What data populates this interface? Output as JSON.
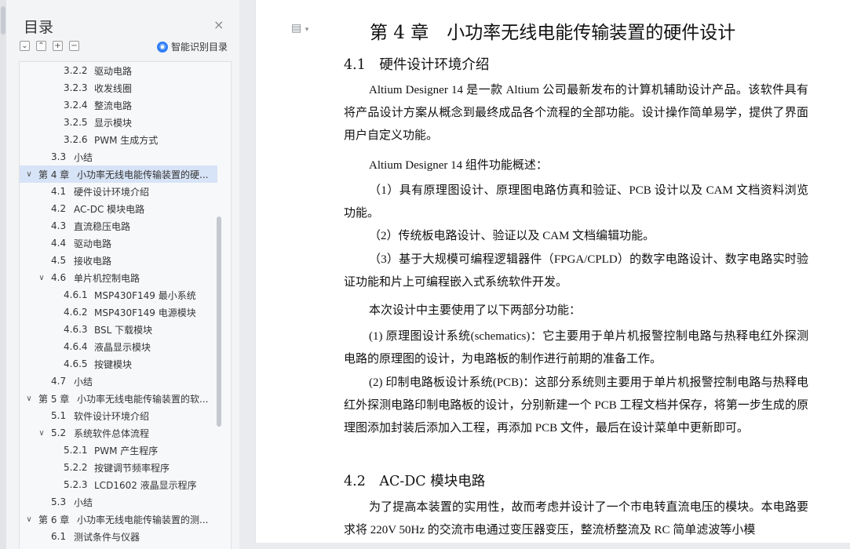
{
  "sidebar": {
    "title": "目录",
    "close_icon": "×",
    "tools": [
      "⌄",
      "⌃",
      "+",
      "−"
    ],
    "smart_toc_label": "智能识别目录",
    "toc": [
      {
        "num": "3.2.2",
        "label": "驱动电路",
        "level": 3
      },
      {
        "num": "3.2.3",
        "label": "收发线圈",
        "level": 3
      },
      {
        "num": "3.2.4",
        "label": "整流电路",
        "level": 3
      },
      {
        "num": "3.2.5",
        "label": "显示模块",
        "level": 3
      },
      {
        "num": "3.2.6",
        "label": "PWM 生成方式",
        "level": 3
      },
      {
        "num": "3.3",
        "label": "小结",
        "level": 2
      },
      {
        "num": "第 4 章",
        "label": "小功率无线电能传输装置的硬...",
        "level": 1,
        "expanded": true,
        "selected": true
      },
      {
        "num": "4.1",
        "label": "硬件设计环境介绍",
        "level": 2
      },
      {
        "num": "4.2",
        "label": "AC-DC 模块电路",
        "level": 2
      },
      {
        "num": "4.3",
        "label": "直流稳压电路",
        "level": 2
      },
      {
        "num": "4.4",
        "label": "驱动电路",
        "level": 2
      },
      {
        "num": "4.5",
        "label": "接收电路",
        "level": 2
      },
      {
        "num": "4.6",
        "label": "单片机控制电路",
        "level": 2,
        "expanded": true
      },
      {
        "num": "4.6.1",
        "label": "MSP430F149 最小系统",
        "level": 3
      },
      {
        "num": "4.6.2",
        "label": "MSP430F149 电源模块",
        "level": 3
      },
      {
        "num": "4.6.3",
        "label": "BSL 下载模块",
        "level": 3
      },
      {
        "num": "4.6.4",
        "label": "液晶显示模块",
        "level": 3
      },
      {
        "num": "4.6.5",
        "label": "按键模块",
        "level": 3
      },
      {
        "num": "4.7",
        "label": "小结",
        "level": 2
      },
      {
        "num": "第 5 章",
        "label": "小功率无线电能传输装置的软...",
        "level": 1,
        "expanded": true
      },
      {
        "num": "5.1",
        "label": "软件设计环境介绍",
        "level": 2
      },
      {
        "num": "5.2",
        "label": "系统软件总体流程",
        "level": 2,
        "expanded": true
      },
      {
        "num": "5.2.1",
        "label": "PWM 产生程序",
        "level": 3
      },
      {
        "num": "5.2.2",
        "label": "按键调节频率程序",
        "level": 3
      },
      {
        "num": "5.2.3",
        "label": "LCD1602 液晶显示程序",
        "level": 3
      },
      {
        "num": "5.3",
        "label": "小结",
        "level": 2
      },
      {
        "num": "第 6 章",
        "label": "小功率无线电能传输装置的测...",
        "level": 1,
        "expanded": true
      },
      {
        "num": "6.1",
        "label": "测试条件与仪器",
        "level": 2
      }
    ]
  },
  "document": {
    "chapter_title": "第 4 章　小功率无线电能传输装置的硬件设计",
    "section1_title": "4.1　硬件设计环境介绍",
    "p1": "Altium Designer 14 是一款 Altium 公司最新发布的计算机辅助设计产品。该软件具有将产品设计方案从概念到最终成品各个流程的全部功能。设计操作简单易学，提供了界面用户自定义功能。",
    "p2": "Altium Designer 14 组件功能概述：",
    "p3": "（1）具有原理图设计、原理图电路仿真和验证、PCB 设计以及 CAM 文档资料浏览功能。",
    "p4": "（2）传统板电路设计、验证以及 CAM 文档编辑功能。",
    "p5": "（3）基于大规模可编程逻辑器件（FPGA/CPLD）的数字电路设计、数字电路实时验证功能和片上可编程嵌入式系统软件开发。",
    "p6": "本次设计中主要使用了以下两部分功能：",
    "p7": "(1) 原理图设计系统(schematics)：它主要用于单片机报警控制电路与热释电红外探测电路的原理图的设计，为电路板的制作进行前期的准备工作。",
    "p8": "(2) 印制电路板设计系统(PCB)：这部分系统则主要用于单片机报警控制电路与热释电红外探测电路印制电路板的设计，分别新建一个 PCB 工程文档并保存，将第一步生成的原理图添加封装后添加入工程，再添加 PCB 文件，最后在设计菜单中更新即可。",
    "section2_title": "4.2　AC-DC 模块电路",
    "p9": "为了提高本装置的实用性，故而考虑并设计了一个市电转直流电压的模块。本电路要求将 220V 50Hz 的交流市电通过变压器变压，整流桥整流及 RC 简单滤波等小模"
  }
}
